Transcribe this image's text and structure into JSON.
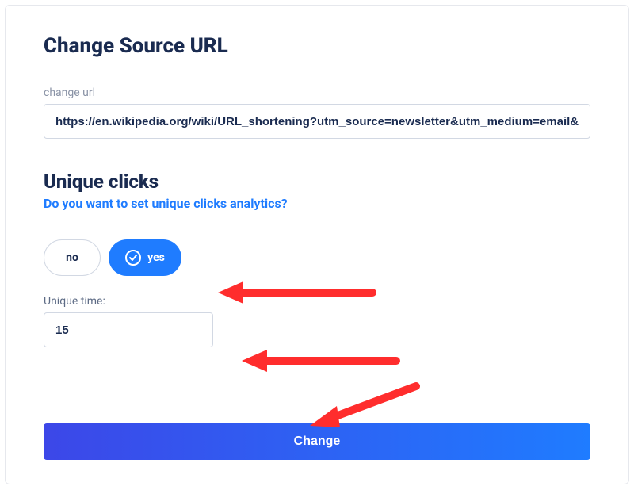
{
  "title": "Change Source URL",
  "url_field": {
    "label": "change url",
    "value": "https://en.wikipedia.org/wiki/URL_shortening?utm_source=newsletter&utm_medium=email&utm_campaign=spring_sale"
  },
  "unique_clicks": {
    "heading": "Unique clicks",
    "prompt": "Do you want to set unique clicks analytics?",
    "no_label": "no",
    "yes_label": "yes",
    "time_label": "Unique time:",
    "time_value": "15"
  },
  "submit_label": "Change"
}
